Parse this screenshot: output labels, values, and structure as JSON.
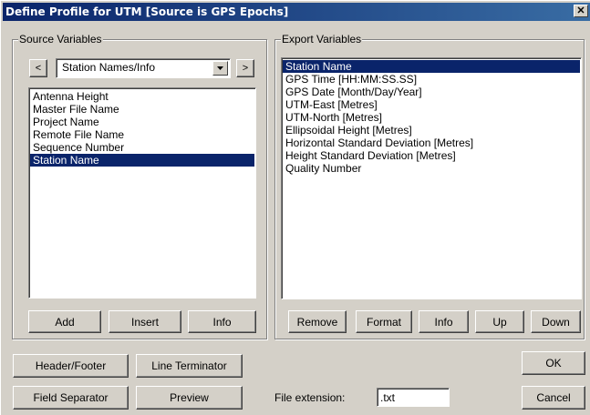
{
  "window": {
    "title": "Define Profile for UTM [Source is GPS Epochs]",
    "close_glyph": "✕"
  },
  "source": {
    "group_label": "Source Variables",
    "prev_glyph": "<",
    "next_glyph": ">",
    "category": "Station Names/Info",
    "items": [
      "Antenna Height",
      "Master File Name",
      "Project Name",
      "Remote File Name",
      "Sequence Number",
      "Station Name"
    ],
    "selected_index": 5,
    "buttons": {
      "add": "Add",
      "insert": "Insert",
      "info": "Info"
    }
  },
  "export": {
    "group_label": "Export Variables",
    "items": [
      "Station Name",
      "GPS Time [HH:MM:SS.SS]",
      "GPS Date [Month/Day/Year]",
      "UTM-East [Metres]",
      "UTM-North [Metres]",
      "Ellipsoidal Height [Metres]",
      "Horizontal Standard Deviation [Metres]",
      "Height Standard Deviation [Metres]",
      "Quality Number"
    ],
    "selected_index": 0,
    "buttons": {
      "remove": "Remove",
      "format": "Format",
      "info": "Info",
      "up": "Up",
      "down": "Down"
    }
  },
  "footer": {
    "header_footer": "Header/Footer",
    "line_terminator": "Line Terminator",
    "field_separator": "Field Separator",
    "preview": "Preview",
    "file_extension_label": "File extension:",
    "file_extension_value": ".txt",
    "ok": "OK",
    "cancel": "Cancel"
  },
  "colors": {
    "face": "#d4d0c8",
    "selection": "#0a246a",
    "title_start": "#0a246a",
    "title_end": "#3a6ea5"
  }
}
